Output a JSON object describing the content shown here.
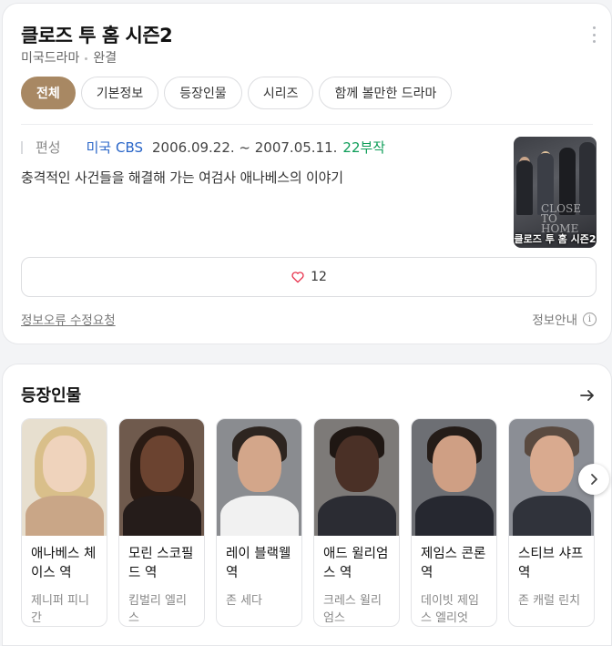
{
  "show": {
    "title": "클로즈 투 홈 시즌2",
    "genre": "미국드라마",
    "status": "완결"
  },
  "tabs": [
    {
      "label": "전체",
      "active": true
    },
    {
      "label": "기본정보",
      "active": false
    },
    {
      "label": "등장인물",
      "active": false
    },
    {
      "label": "시리즈",
      "active": false
    },
    {
      "label": "함께 볼만한 드라마",
      "active": false
    }
  ],
  "info": {
    "label": "편성",
    "network": "미국 CBS",
    "dates": "2006.09.22. ~ 2007.05.11.",
    "episodes": "22부작"
  },
  "synopsis": "충격적인 사건들을 해결해 가는 여검사 애나베스의 이야기",
  "poster": {
    "caption": "클로즈 투 홈 시즌2",
    "logo_line1": "CLOSE",
    "logo_line2": "TO HOME"
  },
  "likes": {
    "count": "12",
    "icon": "heart-outline-icon"
  },
  "footer": {
    "report_label": "정보오류 수정요청",
    "guide_label": "정보안내",
    "guide_icon": "i"
  },
  "cast_section": {
    "title": "등장인물",
    "items": [
      {
        "role": "애나베스 체이스 역",
        "actor": "제니퍼 피니간"
      },
      {
        "role": "모린 스코필드 역",
        "actor": "킴벌리 엘리스"
      },
      {
        "role": "레이 블랙웰 역",
        "actor": "존 세다"
      },
      {
        "role": "애드 윌리엄스 역",
        "actor": "크레스 윌리엄스"
      },
      {
        "role": "제임스 콘론 역",
        "actor": "데이빗 제임스 엘리엇"
      },
      {
        "role": "스티브 샤프 역",
        "actor": "존 캐럴 린치"
      }
    ]
  },
  "colors": {
    "accent": "#a88863",
    "network_link": "#2a66c8",
    "episodes": "#0e9d58",
    "heart": "#e8344e"
  }
}
